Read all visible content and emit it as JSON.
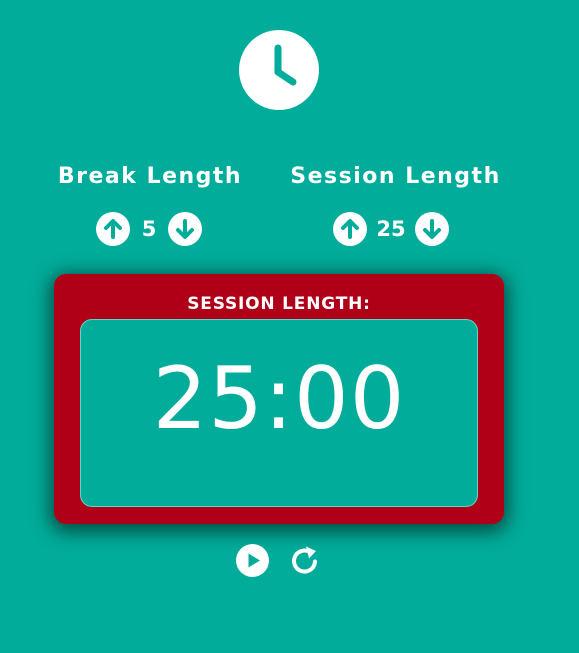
{
  "colors": {
    "background": "#02ac9a",
    "panel": "#b00018",
    "text": "#ffffff"
  },
  "header": {
    "logo_icon": "clock-icon"
  },
  "break": {
    "label": "Break Length",
    "value": "5",
    "increment_icon": "arrow-up-circle-icon",
    "decrement_icon": "arrow-down-circle-icon"
  },
  "session": {
    "label": "Session Length",
    "value": "25",
    "increment_icon": "arrow-up-circle-icon",
    "decrement_icon": "arrow-down-circle-icon"
  },
  "timer": {
    "label": "SESSION LENGTH:",
    "time": "25:00"
  },
  "controls": {
    "play_icon": "play-circle-icon",
    "reset_icon": "refresh-icon"
  }
}
